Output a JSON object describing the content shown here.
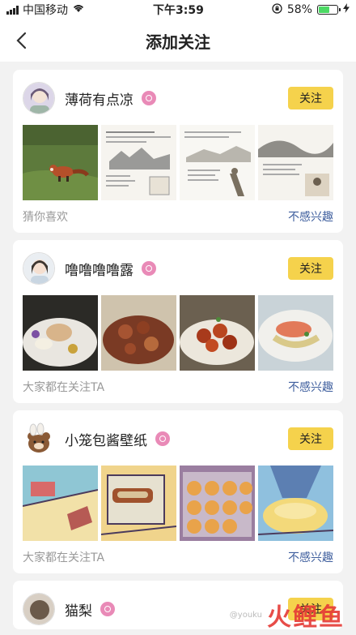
{
  "status_bar": {
    "carrier": "中国移动",
    "time": "下午3:59",
    "battery_percent": "58%",
    "battery_level": 0.58
  },
  "nav": {
    "title": "添加关注"
  },
  "cards": [
    {
      "name": "薄荷有点凉",
      "follow_label": "关注",
      "reason": "猜你喜欢",
      "not_interested_label": "不感兴趣"
    },
    {
      "name": "噜噜噜噜露",
      "follow_label": "关注",
      "reason": "大家都在关注TA",
      "not_interested_label": "不感兴趣"
    },
    {
      "name": "小笼包酱壁纸",
      "follow_label": "关注",
      "reason": "大家都在关注TA",
      "not_interested_label": "不感兴趣"
    },
    {
      "name": "猫梨",
      "follow_label": "关注"
    }
  ],
  "watermark": {
    "logo": "火鲤鱼",
    "text": "@youku"
  }
}
